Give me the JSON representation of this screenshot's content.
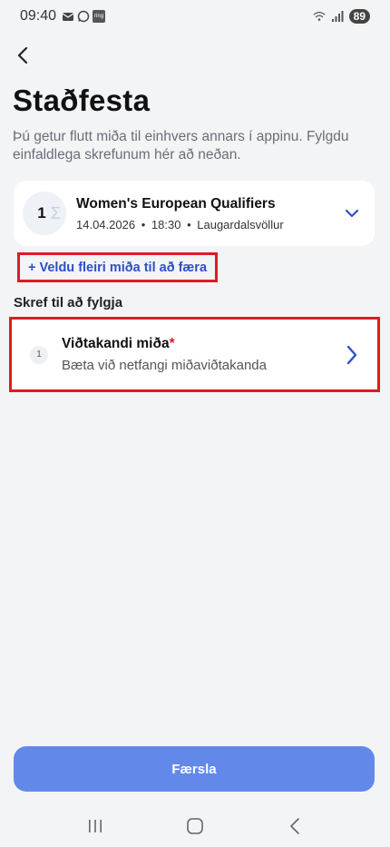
{
  "status_bar": {
    "time": "09:40",
    "battery": "89",
    "app_icon_label": "ring"
  },
  "header": {
    "title": "Staðfesta",
    "description": "Þú getur flutt miða til einhvers annars í appinu. Fylgdu einfaldlega skrefunum hér að neðan."
  },
  "event": {
    "ticket_count": "1",
    "name": "Women's European Qualifiers",
    "date": "14.04.2026",
    "time": "18:30",
    "venue": "Laugardalsvöllur",
    "separator": "•"
  },
  "add_more": {
    "label": "+ Veldu fleiri miða til að færa"
  },
  "steps": {
    "heading": "Skref til að fylgja",
    "items": [
      {
        "number": "1",
        "title": "Viðtakandi miða",
        "required_mark": "*",
        "subtitle": "Bæta við netfangi miðaviðtakanda"
      }
    ]
  },
  "footer": {
    "submit_label": "Færsla"
  },
  "colors": {
    "accent": "#2f4fc4",
    "button": "#6288ea",
    "highlight_border": "#e11a22"
  },
  "icons": {
    "back": "chevron-left-icon",
    "expand": "chevron-down-icon",
    "step_go": "chevron-right-icon",
    "nav_recents": "recents-icon",
    "nav_home": "home-icon",
    "nav_back": "back-nav-icon"
  }
}
